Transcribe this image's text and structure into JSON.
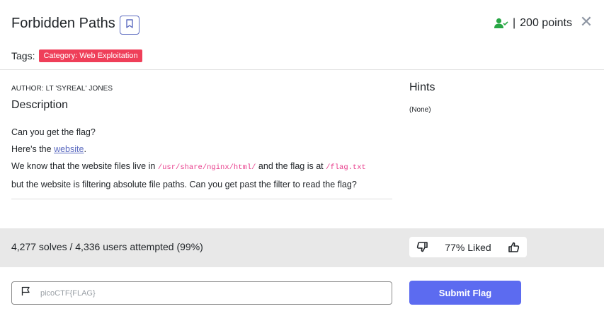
{
  "challenge": {
    "title": "Forbidden Paths",
    "points_sep": "|",
    "points": "200 points",
    "close_glyph": "✕"
  },
  "tags": {
    "label": "Tags:",
    "items": [
      "Category: Web Exploitation"
    ],
    "badge_color": "#ef3f59"
  },
  "description": {
    "author": "AUTHOR: LT 'SYREAL' JONES",
    "heading": "Description",
    "line1": "Can you get the flag?",
    "line2_prefix": "Here's the ",
    "line2_link": "website",
    "line2_suffix": ".",
    "line3_prefix": "We know that the website files live in ",
    "line3_code1": "/usr/share/nginx/html/",
    "line3_mid": " and the flag is at ",
    "line3_code2": "/flag.txt",
    "line4": "but the website is filtering absolute file paths. Can you get past the filter to read the flag?"
  },
  "hints": {
    "heading": "Hints",
    "value": "(None)"
  },
  "stats": {
    "solves": "4,277 solves / 4,336 users attempted (99%)",
    "liked": "77% Liked"
  },
  "submit": {
    "placeholder": "picoCTF{FLAG}",
    "button_label": "Submit Flag",
    "button_color": "#5c6bf0"
  },
  "icons": {
    "bookmark": "bookmark-icon",
    "user_check": "user-check-icon",
    "close": "close-icon",
    "thumbs_down": "thumbs-down-icon",
    "thumbs_up": "thumbs-up-icon",
    "flag": "flag-icon"
  }
}
